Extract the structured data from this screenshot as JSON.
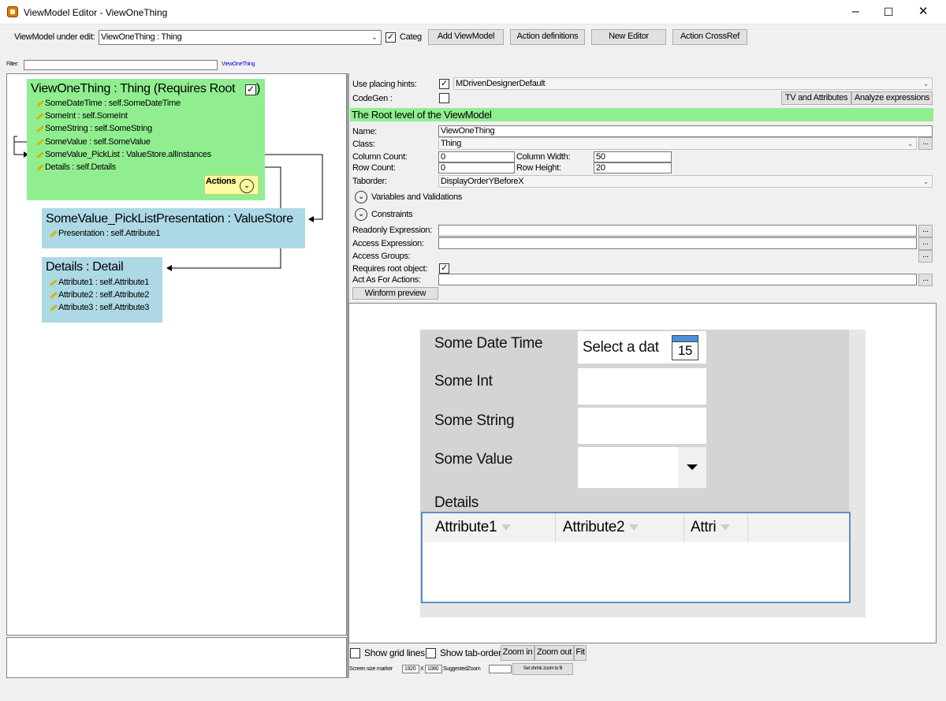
{
  "window": {
    "title": "ViewModel Editor - ViewOneThing",
    "minimize": "–",
    "maximize": "☐",
    "close": "✕"
  },
  "toolbar": {
    "vm_label": "ViewModel under edit:",
    "vm_value": "ViewOneThing : Thing",
    "categ_label": "Categ",
    "categ_checked": true,
    "add_vm": "Add ViewModel",
    "action_defs": "Action definitions",
    "new_editor": "New Editor",
    "action_crossref": "Action CrossRef"
  },
  "filter": {
    "label": "Filter:",
    "value": "",
    "link": "ViewOneThing"
  },
  "tree": {
    "root": {
      "title": "ViewOneThing : Thing  (Requires Root",
      "rows": [
        "SomeDateTime : self.SomeDateTime",
        "SomeInt : self.SomeInt",
        "SomeString : self.SomeString",
        "SomeValue : self.SomeValue",
        "SomeValue_PickList : ValueStore.allInstances",
        "Details : self.Details"
      ],
      "actions": "Actions"
    },
    "picklist": {
      "title": "SomeValue_PickListPresentation : ValueStore",
      "rows": [
        "Presentation : self.Attribute1"
      ]
    },
    "details": {
      "title": "Details : Detail",
      "rows": [
        "Attribute1 : self.Attribute1",
        "Attribute2 : self.Attribute2",
        "Attribute3 : self.Attribute3"
      ]
    }
  },
  "props": {
    "placing_label": "Use placing hints:",
    "placing_checked": true,
    "placing_value": "MDrivenDesignerDefault",
    "codegen_label": "CodeGen :",
    "tv_attrs": "TV and Attributes",
    "analyze": "Analyze expressions",
    "root_banner": "The Root level of the ViewModel",
    "name_label": "Name:",
    "name_value": "ViewOneThing",
    "class_label": "Class:",
    "class_value": "Thing",
    "col_count_label": "Column Count:",
    "col_count": "0",
    "col_width_label": "Column Width:",
    "col_width": "50",
    "row_count_label": "Row Count:",
    "row_count": "0",
    "row_height_label": "Row Height:",
    "row_height": "20",
    "taborder_label": "Taborder:",
    "taborder_value": "DisplayOrderYBeforeX",
    "variables": "Variables and Validations",
    "constraints": "Constraints",
    "readonly_label": "Readonly Expression:",
    "access_label": "Access Expression:",
    "groups_label": "Access Groups:",
    "requires_root_label": "Requires root object:",
    "requires_root_checked": true,
    "act_as_label": "Act As For Actions:",
    "winform_preview": "Winform preview",
    "dots": "..."
  },
  "preview": {
    "date_label": "Some Date Time",
    "date_placeholder": "Select a dat",
    "cal_day": "15",
    "int_label": "Some Int",
    "string_label": "Some String",
    "value_label": "Some Value",
    "details_label": "Details",
    "columns": [
      "Attribute1",
      "Attribute2",
      "Attri"
    ]
  },
  "bottom": {
    "show_grid": "Show grid lines",
    "show_tab": "Show tab-order",
    "zoom_in": "Zoom in",
    "zoom_out": "Zoom out",
    "fit": "Fit",
    "screen_marker": "Screen size marker",
    "w": "1920",
    "x": "X",
    "h": "1080",
    "suggested": "SuggestedZoom",
    "shrink": "Set shrink zoom to fit"
  }
}
